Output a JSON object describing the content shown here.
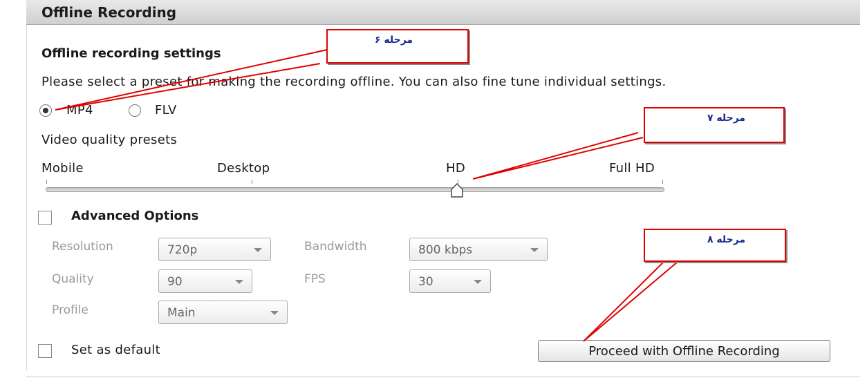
{
  "window": {
    "title": "Offline Recording"
  },
  "settings": {
    "section_title": "Offline recording settings",
    "description": "Please select a preset for making the recording offline. You can also fine tune individual settings.",
    "formats": [
      {
        "label": "MP4",
        "selected": true
      },
      {
        "label": "FLV",
        "selected": false
      }
    ]
  },
  "quality": {
    "label": "Video quality presets",
    "presets": [
      "Mobile",
      "Desktop",
      "HD",
      "Full HD"
    ],
    "selected": "HD"
  },
  "advanced": {
    "label": "Advanced Options",
    "checked": false,
    "resolution": {
      "label": "Resolution",
      "value": "720p"
    },
    "bandwidth": {
      "label": "Bandwidth",
      "value": "800 kbps"
    },
    "quality": {
      "label": "Quality",
      "value": "90"
    },
    "fps": {
      "label": "FPS",
      "value": "30"
    },
    "profile": {
      "label": "Profile",
      "value": "Main"
    }
  },
  "footer": {
    "default_label": "Set as default",
    "default_checked": false,
    "proceed_label": "Proceed with Offline Recording"
  },
  "annotations": {
    "step6": "مرحله ۶",
    "step7": "مرحله ۷",
    "step8": "مرحله ۸",
    "color": "#e00000"
  }
}
